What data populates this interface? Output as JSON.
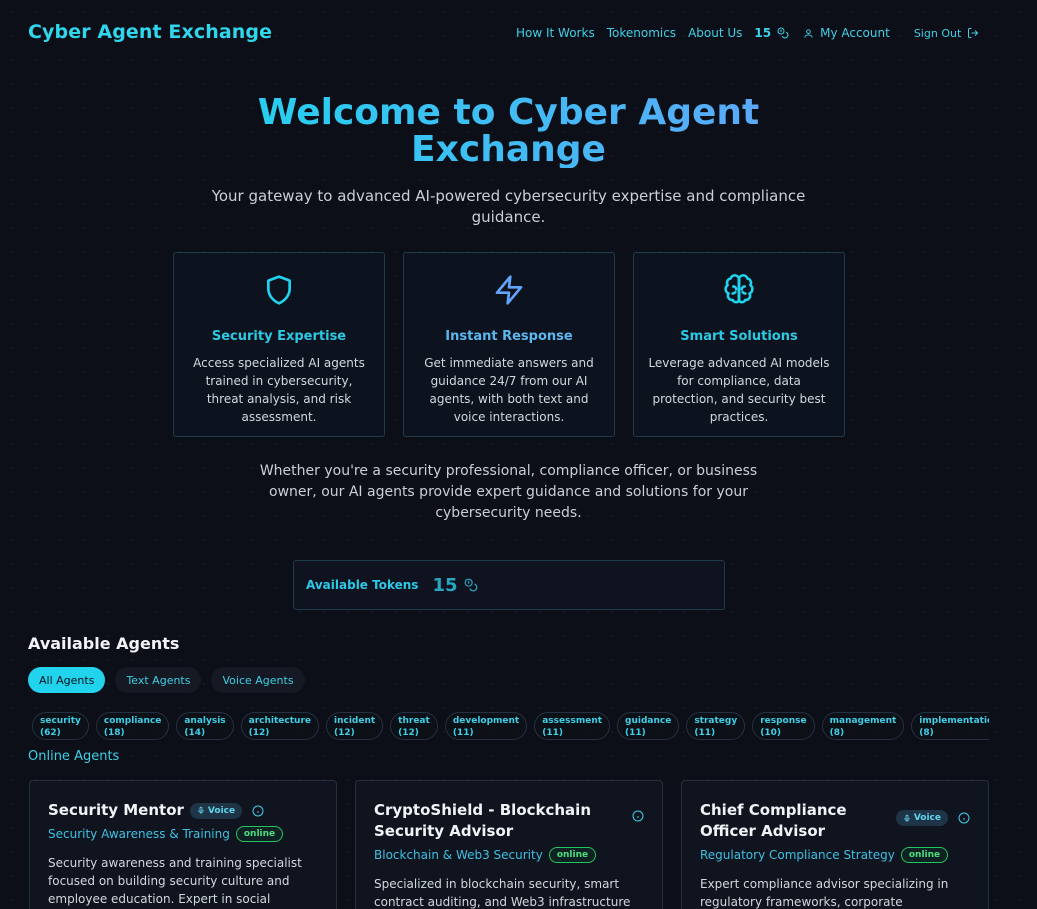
{
  "header": {
    "brand": "Cyber Agent Exchange",
    "nav": {
      "how": "How It Works",
      "tokenomics": "Tokenomics",
      "about": "About Us"
    },
    "token_count": "15",
    "account": "My Account",
    "sign_out": "Sign Out"
  },
  "hero": {
    "title": "Welcome to Cyber Agent Exchange",
    "subtitle": "Your gateway to advanced AI-powered cybersecurity expertise and compliance guidance.",
    "features": [
      {
        "icon": "shield-icon",
        "title": "Security Expertise",
        "text": "Access specialized AI agents trained in cybersecurity, threat analysis, and risk assessment."
      },
      {
        "icon": "lightning-icon",
        "title": "Instant Response",
        "text": "Get immediate answers and guidance 24/7 from our AI agents, with both text and voice interactions."
      },
      {
        "icon": "brain-icon",
        "title": "Smart Solutions",
        "text": "Leverage advanced AI models for compliance, data protection, and security best practices."
      }
    ],
    "blurb": "Whether you're a security professional, compliance officer, or business owner, our AI agents provide expert guidance and solutions for your cybersecurity needs."
  },
  "tokens_panel": {
    "label": "Available Tokens",
    "value": "15"
  },
  "agents": {
    "title": "Available Agents",
    "filters": [
      "All Agents",
      "Text Agents",
      "Voice Agents"
    ],
    "active_filter": "All Agents",
    "tags": [
      {
        "name": "security",
        "count": "(62)"
      },
      {
        "name": "compliance",
        "count": "(18)"
      },
      {
        "name": "analysis",
        "count": "(14)"
      },
      {
        "name": "architecture",
        "count": "(12)"
      },
      {
        "name": "incident",
        "count": "(12)"
      },
      {
        "name": "threat",
        "count": "(12)"
      },
      {
        "name": "development",
        "count": "(11)"
      },
      {
        "name": "assessment",
        "count": "(11)"
      },
      {
        "name": "guidance",
        "count": "(11)"
      },
      {
        "name": "strategy",
        "count": "(11)"
      },
      {
        "name": "response",
        "count": "(10)"
      },
      {
        "name": "management",
        "count": "(8)"
      },
      {
        "name": "implementation",
        "count": "(8)"
      }
    ],
    "online_title": "Online Agents",
    "cards": [
      {
        "name": "Security Mentor",
        "voice": "Voice",
        "category": "Security Awareness & Training",
        "status": "online",
        "description": "Security awareness and training specialist focused on building security culture and employee education. Expert in social"
      },
      {
        "name": "CryptoShield - Blockchain Security Advisor",
        "voice": "",
        "category": "Blockchain & Web3 Security",
        "status": "online",
        "description": "Specialized in blockchain security, smart contract auditing, and Web3 infrastructure"
      },
      {
        "name": "Chief Compliance Officer Advisor",
        "voice": "Voice",
        "category": "Regulatory Compliance Strategy",
        "status": "online",
        "description": "Expert compliance advisor specializing in regulatory frameworks, corporate"
      }
    ]
  },
  "colors": {
    "accent": "#22d3ee",
    "accent_blue": "#60a5fa",
    "online": "#22c55e",
    "background": "#0c0f17"
  }
}
